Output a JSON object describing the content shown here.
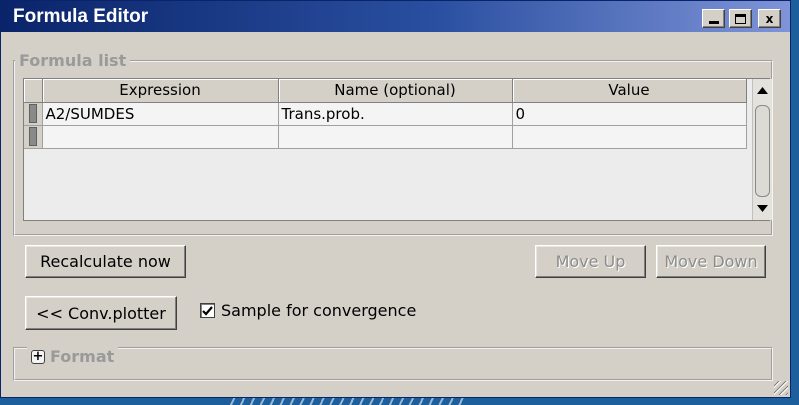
{
  "window": {
    "title": "Formula Editor",
    "controls": {
      "minimize": "_",
      "maximize": "□",
      "close": "x"
    }
  },
  "formula_list": {
    "legend": "Formula list",
    "columns": [
      "Expression",
      "Name (optional)",
      "Value"
    ],
    "rows": [
      {
        "expression": "A2/SUMDES",
        "name": "Trans.prob.",
        "value": "0"
      },
      {
        "expression": "",
        "name": "",
        "value": ""
      }
    ]
  },
  "buttons": {
    "recalculate": "Recalculate now",
    "move_up": "Move Up",
    "move_down": "Move Down",
    "conv_plotter": "<< Conv.plotter"
  },
  "sample_convergence": {
    "label": "Sample for convergence",
    "checked": true
  },
  "format": {
    "label": "Format",
    "expander": "+"
  }
}
